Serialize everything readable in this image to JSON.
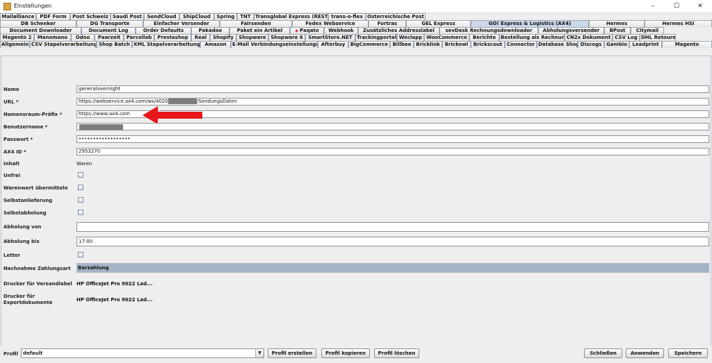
{
  "window": {
    "title": "Einstellungen",
    "controls": [
      "–",
      "☐",
      "✕"
    ]
  },
  "tabs": {
    "row1": [
      "Mailalliance",
      "PDF Form",
      "Post Schweiz",
      "Saudi Post",
      "SendCloud",
      "ShipCloud",
      "Spring",
      "TNT",
      "Transglobal Express (REST)",
      "trans-o-flex",
      "Österreichische Post"
    ],
    "row2": [
      "DB Schenker",
      "DG Transporte",
      "Einfacher Versender",
      "Fairsenden",
      "Fedex Webservice",
      "Fortras",
      "GEL Express",
      "GO! Express & Logistics (AX4)",
      "Hermes",
      "Hermes HSI"
    ],
    "row3": [
      "Document Downloader",
      "Document Log",
      "Order Defaults",
      "Pakadoo",
      "Paket ein Artikel",
      "Paqato",
      "Webhook",
      "Zusätzliches Addresslabel",
      "sevDesk Rechnungsdownloader",
      "Abholungsversender",
      "BPost",
      "Citymail"
    ],
    "row4": [
      "Magento 2",
      "Manomano",
      "Odoo",
      "Paarzeit",
      "Parcellab",
      "Prestashop",
      "Real",
      "Shopify",
      "Shopware",
      "Shopware 6",
      "SmartStore.NET",
      "Trackingportal",
      "Weclapp",
      "WooCommerce",
      "Berichte",
      "Bestellung als Rechnung",
      "CN2x Dokument",
      "CSV Log",
      "DHL Retoure"
    ],
    "row5": [
      "Allgemein",
      "CSV Stapelverarbeitung",
      "Shop Batch",
      "XML Stapelverarbeitung",
      "Amazon",
      "E-Mail Verbindungseinstellungen",
      "Afterbuy",
      "BigCommerce",
      "Billbee",
      "Bricklink",
      "Brickowl",
      "Brickscout",
      "Connector",
      "Database Shop",
      "Discogs",
      "Gambio",
      "Leadprint",
      "Magento"
    ]
  },
  "form": {
    "name_label": "Name",
    "name_value": "generalovernight",
    "url_label": "URL *",
    "url_value_prefix": "https://webservice.ax4.com/ws/4020",
    "url_value_suffix": "/SendungsDaten",
    "namespace_label": "Namensraum-Präfix *",
    "namespace_value": "https://www.ax4.com",
    "username_label": "Benutzername *",
    "password_label": "Passwort *",
    "password_value": "••••••••••••••••••",
    "ax4id_label": "AX4 ID *",
    "ax4id_value": "2953270",
    "inhalt_label": "Inhalt",
    "inhalt_value": "Waren",
    "unfrei_label": "Unfrei",
    "warenwert_label": "Warenwert übermitteln",
    "selbstanlieferung_label": "Selbstanlieferung",
    "selbstabholung_label": "Selbstabholung",
    "abholung_von_label": "Abholung von",
    "abholung_von_value": "",
    "abholung_bis_label": "Abholung bis",
    "abholung_bis_value": "17:00",
    "letter_label": "Letter",
    "nachnahme_label": "Nachnahme Zahlungsart",
    "nachnahme_value": "Barzahlung",
    "drucker_versand_label": "Drucker für Versandlabel",
    "drucker_versand_value": "HP OfficeJet Pro 9022 Lad...",
    "drucker_export_label1": "Drucker für",
    "drucker_export_label2": "Exportdokumente",
    "drucker_export_value": "HP OfficeJet Pro 9022 Lad..."
  },
  "bottom": {
    "profil_label": "Profil",
    "profil_value": "default",
    "profil_erstellen": "Profil erstellen",
    "profil_kopieren": "Profil kopieren",
    "profil_loeschen": "Profil löschen",
    "schliessen": "Schließen",
    "anwenden": "Anwenden",
    "speichern": "Speichern"
  },
  "colors": {
    "active_tab": "#c9d9ea",
    "selected_row": "#a4b5c8",
    "arrow": "#e8161b"
  }
}
